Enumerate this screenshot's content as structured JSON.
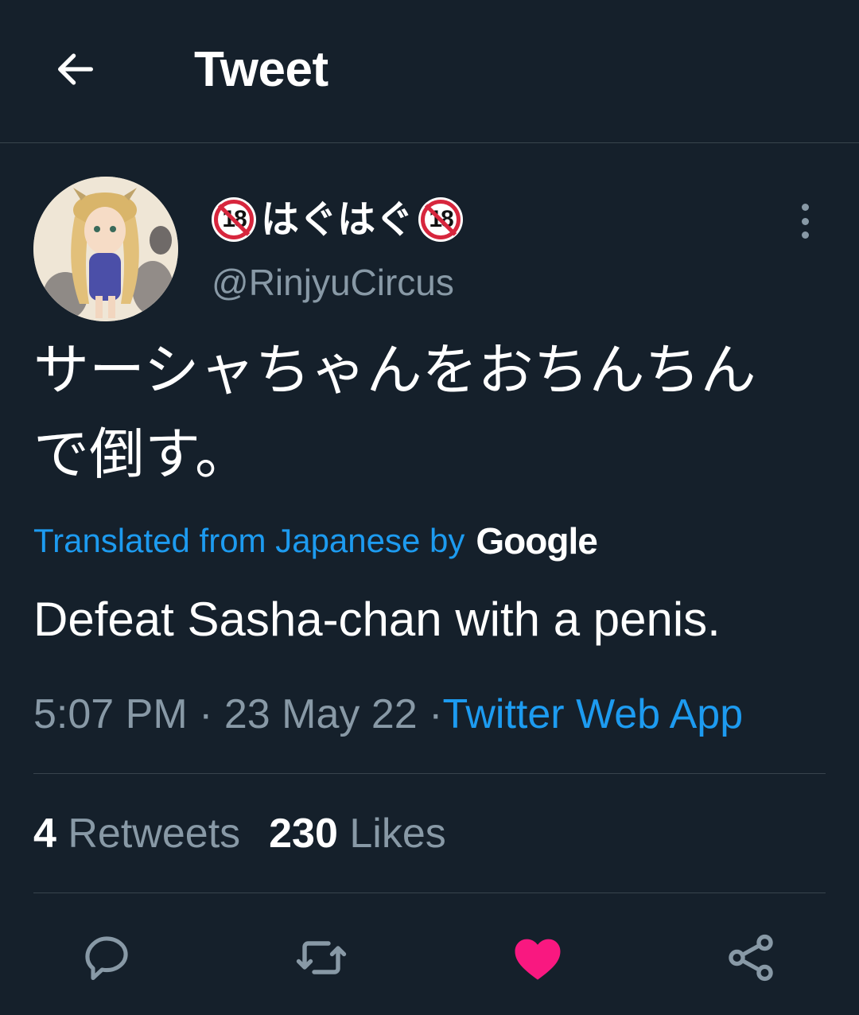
{
  "header": {
    "title": "Tweet",
    "back_icon": "arrow-left-icon"
  },
  "author": {
    "badge_text": "18",
    "display_name_core": "はぐはぐ",
    "handle": "@RinjyuCircus"
  },
  "tweet": {
    "text_line1": "サーシャちゃんをおちんちん",
    "text_line2": "で倒す。",
    "translation_label": "Translated from Japanese by",
    "translation_provider": "Google",
    "translation": "Defeat Sasha-chan with a penis.",
    "time": "5:07 PM",
    "date": "23 May 22",
    "separator": "·",
    "source": "Twitter Web App"
  },
  "stats": {
    "retweets_count": "4",
    "retweets_label": "Retweets",
    "likes_count": "230",
    "likes_label": "Likes"
  },
  "actions": {
    "reply_icon": "reply-icon",
    "retweet_icon": "retweet-icon",
    "like_icon": "heart-icon",
    "share_icon": "share-icon",
    "like_color": "#f91880",
    "icon_color": "#8899a6"
  },
  "colors": {
    "background": "#15202b",
    "accent": "#1d9bf0",
    "muted": "#8899a6",
    "divider": "#38444d"
  }
}
